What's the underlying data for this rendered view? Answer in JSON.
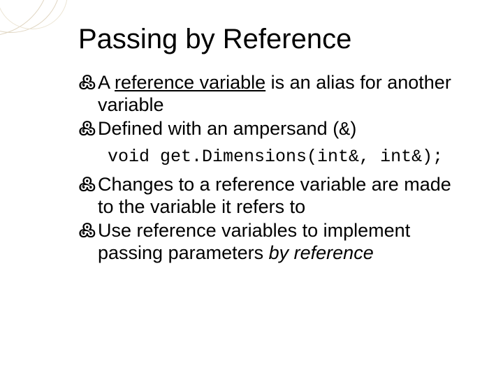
{
  "title": "Passing by Reference",
  "bullets": {
    "b1": {
      "pre": "A ",
      "ul": "reference variable",
      "post": " is an alias for another variable"
    },
    "b2": {
      "pre": "Defined with an ampersand (",
      "code": "&",
      "post": ")"
    },
    "b3": "Changes to a reference variable are made to the variable it refers to",
    "b4": {
      "pre": "Use reference variables to implement passing parameters ",
      "em": "by reference"
    }
  },
  "code_line": "void get.Dimensions(int&, int&);",
  "bullet_glyph": "߷"
}
